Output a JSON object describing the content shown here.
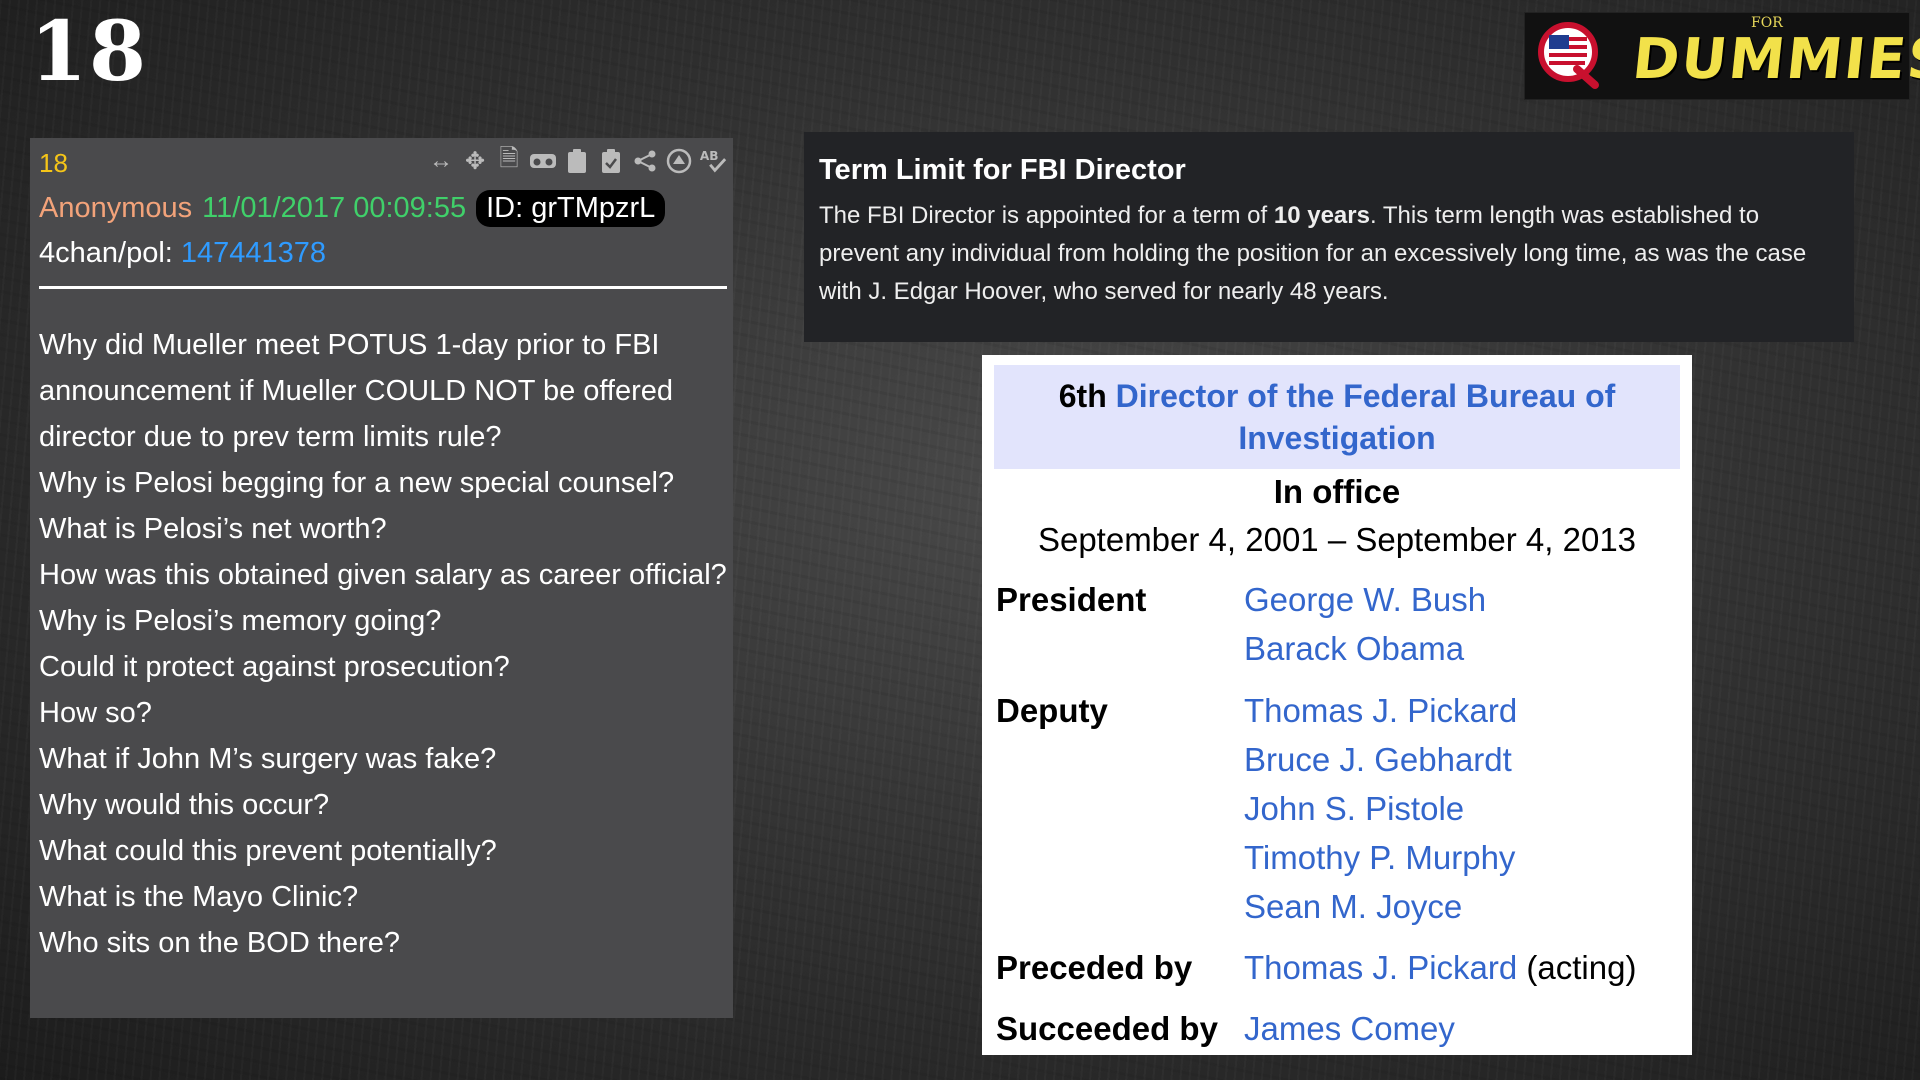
{
  "slide": {
    "number": "18"
  },
  "logo": {
    "letter": "Q",
    "for": "FOR",
    "text": "DUMMIES"
  },
  "post": {
    "number": "18",
    "author": "Anonymous",
    "datetime": "11/01/2017 00:09:55",
    "id": "ID: grTMpzrL",
    "board_prefix": "4chan/pol:",
    "thread_link": "147441378",
    "toolbar_icons": [
      "expand-horizontal-icon",
      "move-icon",
      "document-icon",
      "vr-glasses-icon",
      "clipboard-icon",
      "clipboard-check-icon",
      "share-icon",
      "up-arrow-circle-icon",
      "spellcheck-icon"
    ],
    "lines": [
      "Why did Mueller meet POTUS 1-day prior to FBI announcement if Mueller COULD NOT be offered director due to prev term limits rule?",
      "Why is Pelosi begging for a new special counsel?",
      "What is Pelosi’s net worth?",
      "How was this obtained given salary as career official?",
      "Why is Pelosi’s memory going?",
      "Could it protect against prosecution?",
      "How so?",
      "What if John M’s surgery was fake?",
      "Why would this occur?",
      "What could this prevent potentially?",
      "What is the Mayo Clinic?",
      "Who sits on the BOD there?"
    ]
  },
  "definition": {
    "title": "Term Limit for FBI Director",
    "text_before": "The FBI Director is appointed for a term of ",
    "text_bold": "10 years",
    "text_after": ". This term length was established to prevent any individual from holding the position for an excessively long time, as was the case with J. Edgar Hoover, who served for nearly 48 years."
  },
  "infobox": {
    "ordinal": "6th",
    "title_link": "Director of the Federal Bureau of Investigation",
    "office_label": "In office",
    "office_dates": "September 4, 2001 – September 4, 2013",
    "president_label": "President",
    "presidents": [
      "George W. Bush",
      "Barack Obama"
    ],
    "deputy_label": "Deputy",
    "deputies": [
      "Thomas J. Pickard",
      "Bruce J. Gebhardt",
      "John S. Pistole",
      "Timothy P. Murphy",
      "Sean M. Joyce"
    ],
    "preceded_label": "Preceded by",
    "preceded_name": "Thomas J. Pickard",
    "preceded_note": "(acting)",
    "succeeded_label": "Succeeded by",
    "succeeded_name": "James Comey"
  },
  "colors": {
    "post_bg": "#4a4a4c",
    "post_number": "#f5c518",
    "author": "#f3a37a",
    "datetime": "#40d06a",
    "link_blue": "#2f9bff",
    "wiki_link": "#3366cc",
    "infobox_header_bg": "#e2e4fc",
    "logo_text": "#f2e14a"
  }
}
